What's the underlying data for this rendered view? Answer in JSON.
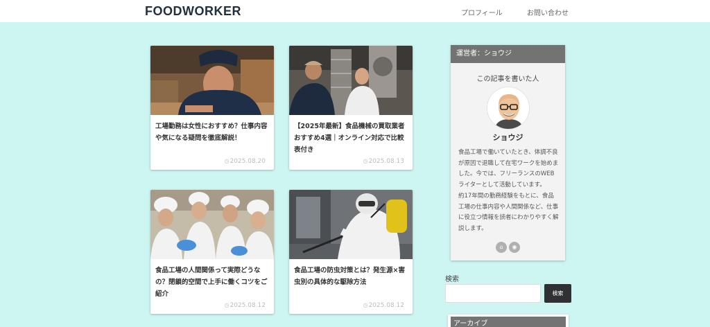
{
  "header": {
    "logo": "FOODWORKER",
    "nav": [
      {
        "label": "プロフィール"
      },
      {
        "label": "お問い合わせ"
      }
    ]
  },
  "articles": [
    {
      "title": "工場勤務は女性におすすめ？仕事内容や気になる疑問を徹底解説！",
      "date": "2025.08.20"
    },
    {
      "title": "【2025年最新】食品機械の買取業者おすすめ4選｜オンライン対応で比較表付き",
      "date": "2025.08.13"
    },
    {
      "title": "食品工場の人間関係って実際どうなの？閉鎖的空間で上手に働くコツをご紹介",
      "date": "2025.08.12"
    },
    {
      "title": "食品工場の防虫対策とは？発生源×害虫別の具体的な駆除方法",
      "date": "2025.08.12"
    }
  ],
  "sidebar": {
    "header": "運営者：ショウジ",
    "author_label": "この記事を書いた人",
    "author_name": "ショウジ",
    "bio_1": "食品工場で働いていたとき、体調不良が原因で退職して在宅ワークを始めました。今では、フリーランスのWEBライターとして活動しています。",
    "bio_2": "約17年間の勤務経験をもとに、食品工場の仕事内容や人間関係など、仕事に役立つ情報を読者にわかりやすく解説します。",
    "social": [
      {
        "icon": "home-icon",
        "symbol": "⌂"
      },
      {
        "icon": "rss-icon",
        "symbol": "◉"
      }
    ]
  },
  "search": {
    "label": "検索",
    "placeholder": "",
    "button": "検索"
  },
  "archive": {
    "header": "アーカイブ"
  },
  "colors": {
    "background": "#cdf5f1",
    "widget_header": "#737373",
    "search_button": "#2f3133"
  }
}
